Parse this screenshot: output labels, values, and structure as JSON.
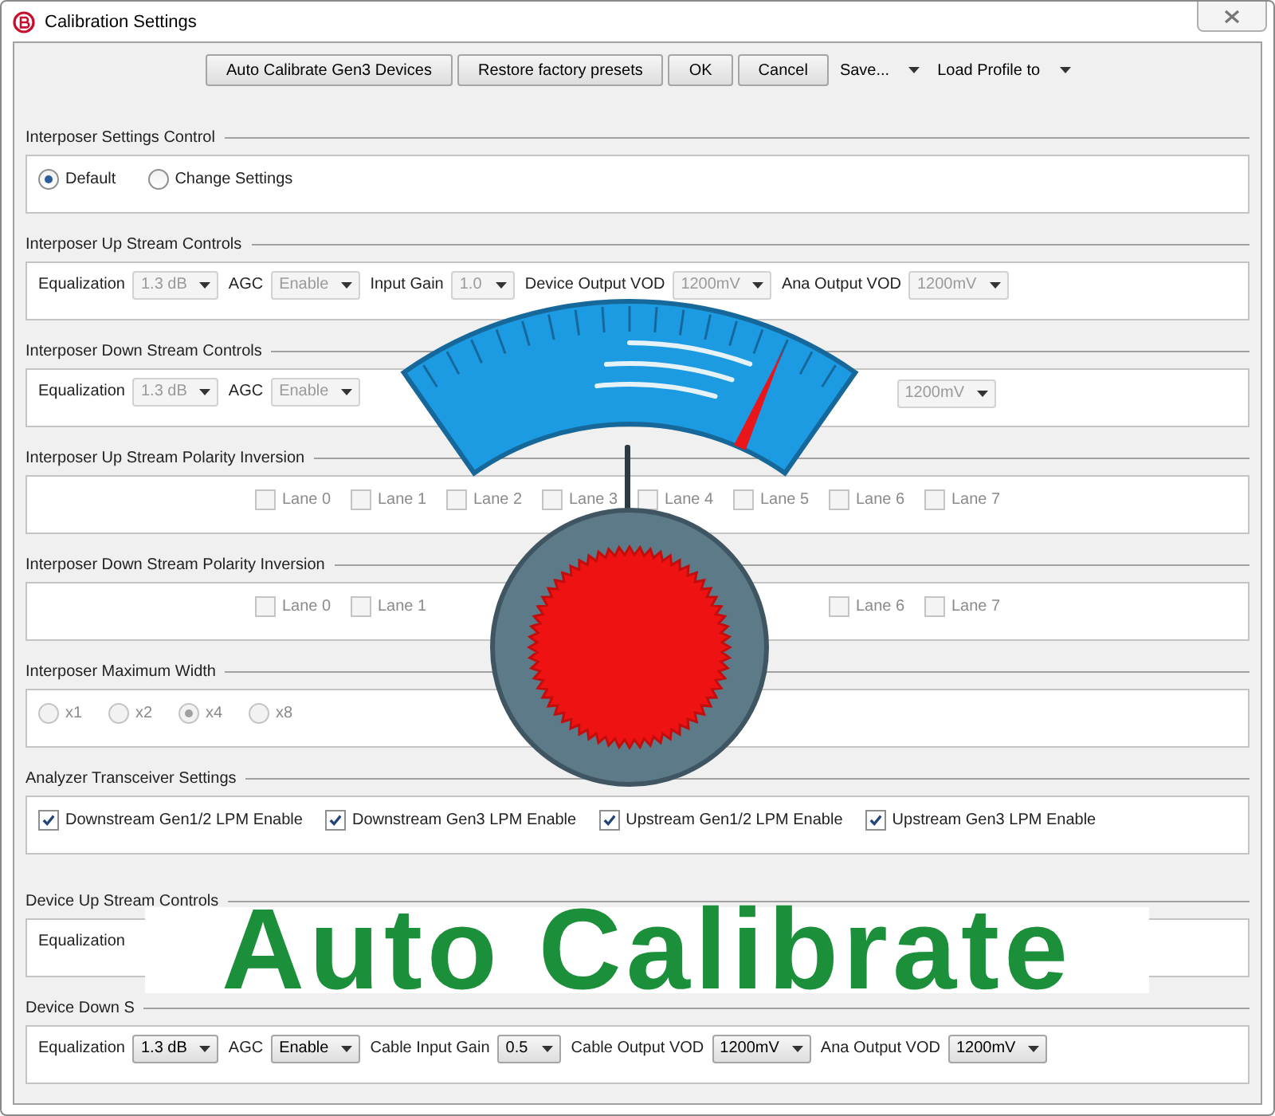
{
  "window": {
    "title": "Calibration Settings"
  },
  "toolbar": {
    "buttons": [
      "Auto Calibrate Gen3 Devices",
      "Restore factory presets",
      "OK",
      "Cancel"
    ],
    "menus": [
      "Save...",
      "Load Profile to"
    ]
  },
  "sections": [
    {
      "title": "Interposer Settings Control",
      "kind": "radios",
      "options": [
        {
          "label": "Default",
          "selected": true,
          "disabled": false
        },
        {
          "label": "Change Settings",
          "selected": false,
          "disabled": false
        }
      ]
    },
    {
      "title": "Interposer Up Stream Controls",
      "kind": "controls",
      "items": [
        {
          "label": "Equalization",
          "value": "1.3 dB",
          "disabled": true
        },
        {
          "label": "AGC",
          "value": "Enable",
          "disabled": true
        },
        {
          "label": "Input Gain",
          "value": "1.0",
          "disabled": true
        },
        {
          "label": "Device Output VOD",
          "value": "1200mV",
          "disabled": true
        },
        {
          "label": "Ana Output VOD",
          "value": "1200mV",
          "disabled": true
        }
      ]
    },
    {
      "title": "Interposer Down Stream Controls",
      "kind": "controls",
      "items": [
        {
          "label": "Equalization",
          "value": "1.3 dB",
          "disabled": true
        },
        {
          "label": "AGC",
          "value": "Enable",
          "disabled": true
        }
      ],
      "items_right": [
        {
          "value": "1200mV",
          "disabled": true
        }
      ]
    },
    {
      "title": "Interposer Up Stream Polarity Inversion",
      "kind": "lanes",
      "lanes": [
        {
          "label": "Lane 0",
          "checked": false,
          "disabled": true
        },
        {
          "label": "Lane 1",
          "checked": false,
          "disabled": true
        },
        {
          "label": "Lane 2",
          "checked": false,
          "disabled": true
        },
        {
          "label": "Lane 3",
          "checked": false,
          "disabled": true
        },
        {
          "label": "Lane 4",
          "checked": false,
          "disabled": true
        },
        {
          "label": "Lane 5",
          "checked": false,
          "disabled": true
        },
        {
          "label": "Lane 6",
          "checked": false,
          "disabled": true
        },
        {
          "label": "Lane 7",
          "checked": false,
          "disabled": true
        }
      ]
    },
    {
      "title": "Interposer Down Stream Polarity Inversion",
      "kind": "lanes",
      "lanes": [
        {
          "label": "Lane 0",
          "checked": false,
          "disabled": true
        },
        {
          "label": "Lane 1",
          "checked": false,
          "disabled": true
        }
      ],
      "lanes_right": [
        {
          "label": "Lane 6",
          "checked": false,
          "disabled": true
        },
        {
          "label": "Lane 7",
          "checked": false,
          "disabled": true
        }
      ]
    },
    {
      "title": "Interposer Maximum Width",
      "kind": "radios",
      "options": [
        {
          "label": "x1",
          "selected": false,
          "disabled": true
        },
        {
          "label": "x2",
          "selected": false,
          "disabled": true
        },
        {
          "label": "x4",
          "selected": true,
          "disabled": true
        },
        {
          "label": "x8",
          "selected": false,
          "disabled": true
        }
      ]
    },
    {
      "title": "Analyzer Transceiver Settings",
      "kind": "checks",
      "items": [
        {
          "label": "Downstream Gen1/2 LPM Enable",
          "checked": true,
          "disabled": false
        },
        {
          "label": "Downstream Gen3 LPM Enable",
          "checked": true,
          "disabled": false
        },
        {
          "label": "Upstream Gen1/2 LPM Enable",
          "checked": true,
          "disabled": false
        },
        {
          "label": "Upstream Gen3 LPM Enable",
          "checked": true,
          "disabled": false
        }
      ]
    },
    {
      "title": "Device Up Stream Controls",
      "kind": "controls",
      "items": [
        {
          "label": "Equalization"
        }
      ]
    },
    {
      "title": "Device Down S",
      "kind": "controls",
      "items": [
        {
          "label": "Equalization",
          "value": "1.3 dB",
          "disabled": false
        },
        {
          "label": "AGC",
          "value": "Enable",
          "disabled": false
        },
        {
          "label": "Cable Input Gain",
          "value": "0.5",
          "disabled": false
        },
        {
          "label": "Cable Output VOD",
          "value": "1200mV",
          "disabled": false
        },
        {
          "label": "Ana Output VOD",
          "value": "1200mV",
          "disabled": false
        }
      ]
    }
  ],
  "overlay": {
    "banner": "Auto Calibrate"
  }
}
